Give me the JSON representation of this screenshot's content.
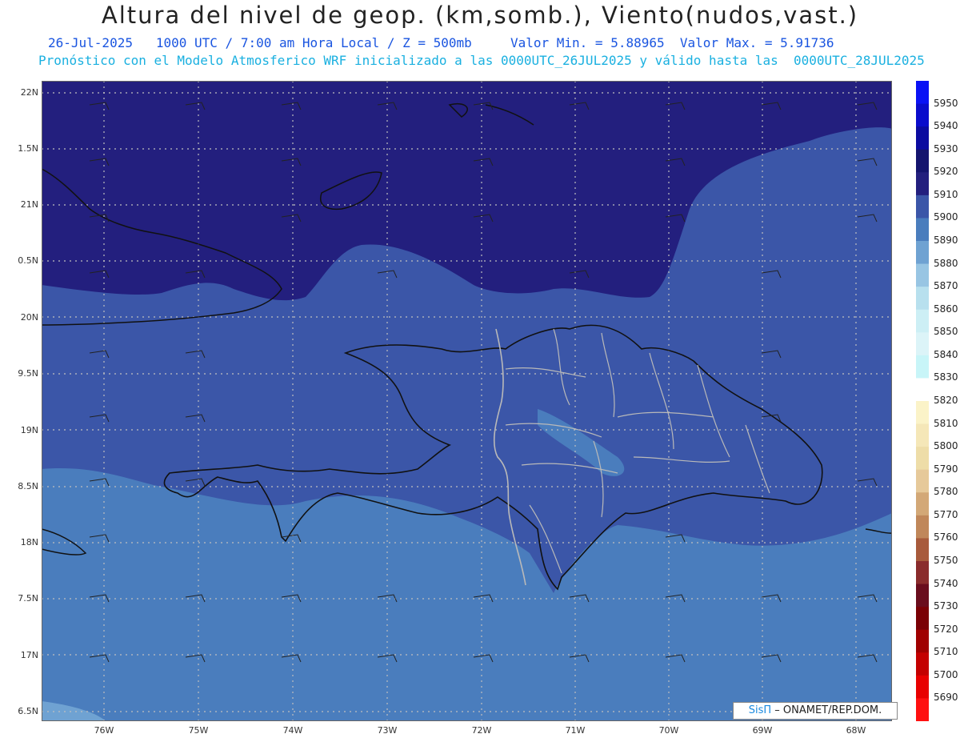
{
  "header": {
    "title": "Altura del nivel de geop. (km,somb.), Viento(nudos,vast.)",
    "line1": "26-Jul-2025   1000 UTC / 7:00 am Hora Local / Z = 500mb     Valor Min. = 5.88965  Valor Max. = 5.91736",
    "line2": "Pronóstico con el Modelo Atmosferico WRF inicializado a las 0000UTC_26JUL2025 y válido hasta las  0000UTC_28JUL2025"
  },
  "axes": {
    "lat_labels": [
      "22N",
      "1.5N",
      "21N",
      "0.5N",
      "20N",
      "9.5N",
      "19N",
      "8.5N",
      "18N",
      "7.5N",
      "17N",
      "6.5N"
    ],
    "lon_labels": [
      "76W",
      "75W",
      "74W",
      "73W",
      "72W",
      "71W",
      "70W",
      "69W",
      "68W"
    ]
  },
  "colorbar": {
    "labels": [
      "5950",
      "5940",
      "5930",
      "5920",
      "5910",
      "5900",
      "5890",
      "5880",
      "5870",
      "5860",
      "5850",
      "5840",
      "5830",
      "5820",
      "5810",
      "5800",
      "5790",
      "5780",
      "5770",
      "5760",
      "5750",
      "5740",
      "5730",
      "5720",
      "5710",
      "5700",
      "5690"
    ],
    "colors": [
      "#0a12f5",
      "#0a0ccc",
      "#0b0ba0",
      "#14146e",
      "#231f7e",
      "#3b56a8",
      "#4a7dbd",
      "#6fa2d2",
      "#98c5e3",
      "#b8e0ee",
      "#cdeff5",
      "#dcf4f8",
      "#c8f5f8",
      "#ffffff",
      "#fbf3c8",
      "#f5e7b8",
      "#eedda8",
      "#e6c99a",
      "#d3a877",
      "#c0875a",
      "#a85b3c",
      "#8a2c2c",
      "#6a0d1d",
      "#7a0005",
      "#a00000",
      "#c40000",
      "#e80000",
      "#ff1010"
    ]
  },
  "map_colors": {
    "north": "#231f7e",
    "mid": "#3b56a8",
    "south": "#4a7dbd",
    "light": "#6fa2d2"
  },
  "credit": {
    "sis": "SisΠ",
    "rest": " – ONAMET/REP.DOM."
  }
}
